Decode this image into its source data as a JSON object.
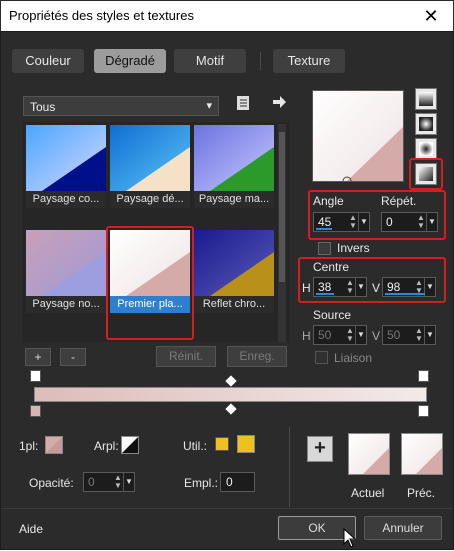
{
  "window": {
    "title": "Propriétés des styles et textures",
    "close_glyph": "✕"
  },
  "tabs": [
    {
      "label": "Couleur",
      "active": false
    },
    {
      "label": "Dégradé",
      "active": true
    },
    {
      "label": "Motif",
      "active": false
    },
    {
      "label": "Texture",
      "active": false
    }
  ],
  "category_select": {
    "value": "Tous",
    "arrow": "▾"
  },
  "gradients": [
    {
      "label": "Paysage co...",
      "selected": false
    },
    {
      "label": "Paysage dé...",
      "selected": false
    },
    {
      "label": "Paysage ma...",
      "selected": false
    },
    {
      "label": "Paysage no...",
      "selected": false
    },
    {
      "label": "Premier pla...",
      "selected": true
    },
    {
      "label": "Reflet chro...",
      "selected": false
    }
  ],
  "list_buttons": {
    "add": "+",
    "remove": "-",
    "reset": "Réinit.",
    "save": "Enreg."
  },
  "angle": {
    "label": "Angle",
    "value": "45"
  },
  "repeat": {
    "label": "Répét.",
    "value": "0"
  },
  "invert": {
    "label": "Invers"
  },
  "centre": {
    "label": "Centre",
    "h_label": "H",
    "h_value": "38",
    "v_label": "V",
    "v_value": "98"
  },
  "source": {
    "label": "Source",
    "h_label": "H",
    "h_value": "50",
    "v_label": "V",
    "v_value": "50"
  },
  "link": {
    "label": "Liaison"
  },
  "stops": {
    "mode_label": "1pl:",
    "arrow_label": "Arpl:",
    "util_label": "Util.:",
    "opacity_label": "Opacité:",
    "opacity_value": "0",
    "location_label": "Empl.:",
    "location_value": "0"
  },
  "preview": {
    "add_symbol": "+",
    "current_label": "Actuel",
    "previous_label": "Préc."
  },
  "footer": {
    "help": "Aide",
    "ok": "OK",
    "cancel": "Annuler"
  },
  "colors": {
    "gradient_start": "#f8f2f2",
    "gradient_end": "#d6aaa8",
    "accent": "#2f7fd0",
    "highlight": "#d31f1f",
    "util_yellow": "#f0c020"
  }
}
